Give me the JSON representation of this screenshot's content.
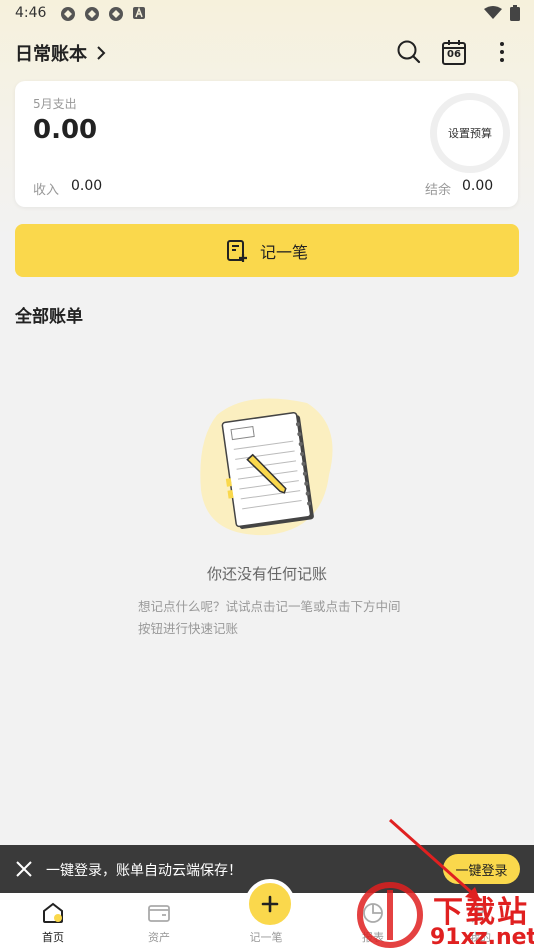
{
  "status_bar": {
    "time": "4:46"
  },
  "header": {
    "title": "日常账本"
  },
  "summary": {
    "month_label": "5月支出",
    "expense_value": "0.00",
    "budget_label": "设置预算",
    "income_label": "收入",
    "income_value": "0.00",
    "balance_label": "结余",
    "balance_value": "0.00"
  },
  "calendar_day": "06",
  "record_button": {
    "label": "记一笔"
  },
  "section": {
    "title": "全部账单"
  },
  "empty_state": {
    "title": "你还没有任何记账",
    "hint": "想记点什么呢？试试点击记一笔或点击下方中间按钮进行快速记账"
  },
  "login_banner": {
    "message": "一键登录，账单自动云端保存！",
    "button": "一键登录"
  },
  "bottom_nav": {
    "items": [
      {
        "label": "首页",
        "icon": "home-icon"
      },
      {
        "label": "资产",
        "icon": "wallet-icon"
      },
      {
        "label": "记一笔",
        "icon": "plus-icon"
      },
      {
        "label": "报表",
        "icon": "report-icon"
      },
      {
        "label": "我的",
        "icon": "user-icon"
      }
    ]
  },
  "watermark": {
    "text1": "下载站",
    "text2": "91xz.net"
  },
  "colors": {
    "accent": "#fad84c",
    "banner_bg": "#3a3a3a",
    "watermark_red": "#e02020"
  }
}
